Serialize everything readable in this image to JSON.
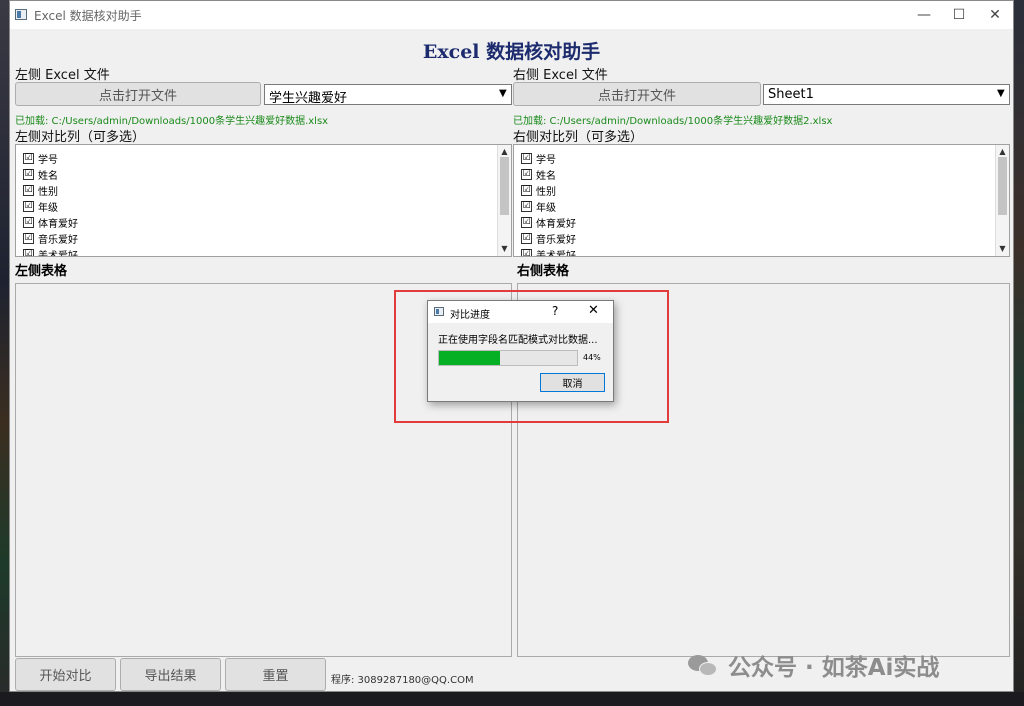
{
  "window": {
    "title": "Excel 数据核对助手",
    "heading": "Excel 数据核对助手",
    "controls": {
      "minimize": "—",
      "maximize": "☐",
      "close": "✕"
    }
  },
  "left": {
    "file_label": "左侧 Excel 文件",
    "open_button": "点击打开文件",
    "sheet": "学生兴趣爱好",
    "loaded_path": "已加载: C:/Users/admin/Downloads/1000条学生兴趣爱好数据.xlsx",
    "columns_label": "左侧对比列（可多选）",
    "columns": [
      {
        "label": "学号",
        "checked": "☑"
      },
      {
        "label": "姓名",
        "checked": "☑"
      },
      {
        "label": "性别",
        "checked": "☑"
      },
      {
        "label": "年级",
        "checked": "☑"
      },
      {
        "label": "体育爱好",
        "checked": "☑"
      },
      {
        "label": "音乐爱好",
        "checked": "☑"
      },
      {
        "label": "美术爱好",
        "checked": "☑"
      }
    ],
    "table_label": "左侧表格"
  },
  "right": {
    "file_label": "右侧 Excel 文件",
    "open_button": "点击打开文件",
    "sheet": "Sheet1",
    "loaded_path": "已加载: C:/Users/admin/Downloads/1000条学生兴趣爱好数据2.xlsx",
    "columns_label": "右侧对比列（可多选）",
    "columns": [
      {
        "label": "学号",
        "checked": "☑"
      },
      {
        "label": "姓名",
        "checked": "☑"
      },
      {
        "label": "性别",
        "checked": "☑"
      },
      {
        "label": "年级",
        "checked": "☑"
      },
      {
        "label": "体育爱好",
        "checked": "☑"
      },
      {
        "label": "音乐爱好",
        "checked": "☑"
      },
      {
        "label": "美术爱好",
        "checked": "☑"
      }
    ],
    "table_label": "右侧表格"
  },
  "footer": {
    "start_button": "开始对比",
    "export_button": "导出结果",
    "reset_button": "重置",
    "note": "程序: 3089287180@QQ.COM"
  },
  "dialog": {
    "title": "对比进度",
    "help": "?",
    "close": "✕",
    "message": "正在使用字段名匹配模式对比数据...",
    "progress_percent": 44,
    "progress_text": "44%",
    "cancel_button": "取消"
  },
  "watermark": {
    "text": "公众号 · 如茶Ai实战"
  },
  "colors": {
    "heading": "#1c2b6e",
    "loaded_text": "#1a8a1a",
    "progress_fill": "#06b025",
    "highlight": "#e23b3b"
  }
}
